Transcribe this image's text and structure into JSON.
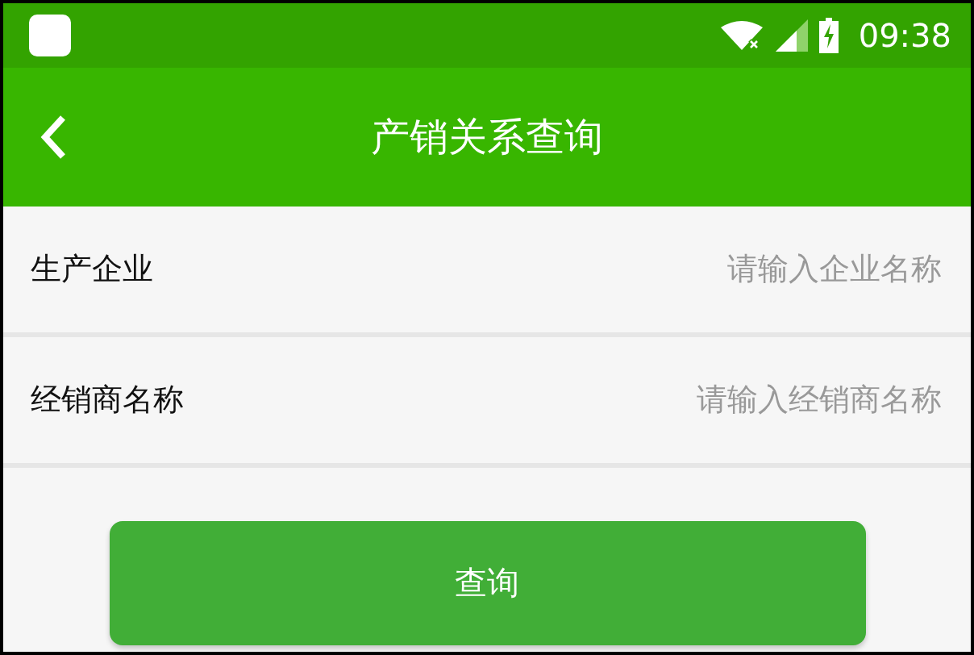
{
  "status_bar": {
    "time": "09:38"
  },
  "app_bar": {
    "title": "产销关系查询"
  },
  "fields": [
    {
      "label": "生产企业",
      "placeholder": "请输入企业名称"
    },
    {
      "label": "经销商名称",
      "placeholder": "请输入经销商名称"
    }
  ],
  "button": {
    "label": "查询"
  }
}
